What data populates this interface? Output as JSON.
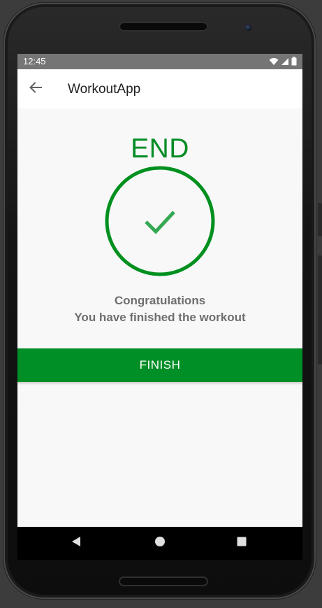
{
  "status_bar": {
    "time": "12:45",
    "icons": [
      "wifi-icon",
      "signal-icon",
      "battery-icon"
    ]
  },
  "app_bar": {
    "back_icon": "arrow-back-icon",
    "title": "WorkoutApp"
  },
  "main": {
    "heading": "END",
    "check_icon": "check-icon",
    "message_line1": "Congratulations",
    "message_line2": "You have finished the workout",
    "finish_label": "FINISH"
  },
  "nav_bar": {
    "items": [
      "back-triangle-icon",
      "home-circle-icon",
      "recents-square-icon"
    ]
  },
  "colors": {
    "accent": "#008f27",
    "heading": "#008c24",
    "message": "#6e6e6e",
    "status_bar": "#757575"
  }
}
